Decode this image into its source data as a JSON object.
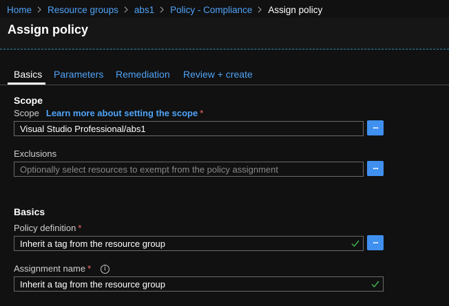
{
  "breadcrumb": {
    "items": [
      "Home",
      "Resource groups",
      "abs1",
      "Policy - Compliance"
    ],
    "current": "Assign policy"
  },
  "page": {
    "title": "Assign policy"
  },
  "tabs": [
    {
      "label": "Basics",
      "active": true
    },
    {
      "label": "Parameters"
    },
    {
      "label": "Remediation"
    },
    {
      "label": "Review + create"
    }
  ],
  "scope": {
    "heading": "Scope",
    "scope_label": "Scope",
    "scope_link": "Learn more about setting the scope",
    "scope_value": "Visual Studio Professional/abs1",
    "exclusions_label": "Exclusions",
    "exclusions_placeholder": "Optionally select resources to exempt from the policy assignment",
    "browse_label": "..."
  },
  "basics": {
    "heading": "Basics",
    "policy_definition_label": "Policy definition",
    "policy_definition_value": "Inherit a tag from the resource group",
    "assignment_name_label": "Assignment name",
    "assignment_name_value": "Inherit a tag from the resource group"
  },
  "required_marker": "*",
  "colors": {
    "accent": "#4090f0",
    "link": "#4fa3f7",
    "required": "#ff6b6b",
    "valid": "#3fb950"
  }
}
